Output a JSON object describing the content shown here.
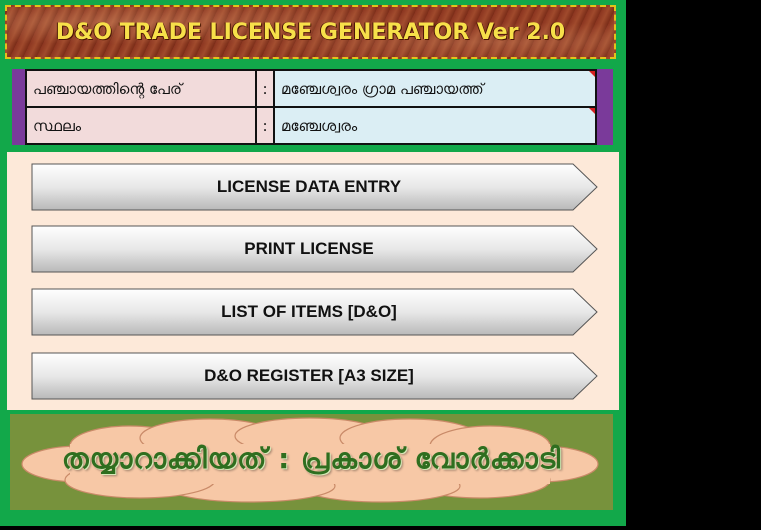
{
  "title": "D&O TRADE LICENSE GENERATOR Ver 2.0",
  "info": {
    "rows": [
      {
        "label": "പഞ്ചായത്തിന്റെ പേര്",
        "colon": ":",
        "value": "മഞ്ചേശ്വരം ഗ്രാമ പഞ്ചായത്ത്"
      },
      {
        "label": "സ്ഥലം",
        "colon": ":",
        "value": "മഞ്ചേശ്വരം"
      }
    ]
  },
  "menu": {
    "license_data_entry": "LICENSE DATA ENTRY",
    "print_license": "PRINT LICENSE",
    "list_of_items": "LIST OF ITEMS [D&O]",
    "register": "D&O REGISTER [A3 SIZE]"
  },
  "credit": "തയ്യാറാക്കിയത് : പ്രകാശ് വോർക്കാടി",
  "colors": {
    "frame_green": "#12a84a",
    "banner_brown": "#8b3520",
    "title_yellow": "#f7e04a",
    "label_pink": "#f2dbdb",
    "value_blue": "#dbeef4",
    "menu_bg": "#fde9d9",
    "credit_olive": "#77923c"
  }
}
